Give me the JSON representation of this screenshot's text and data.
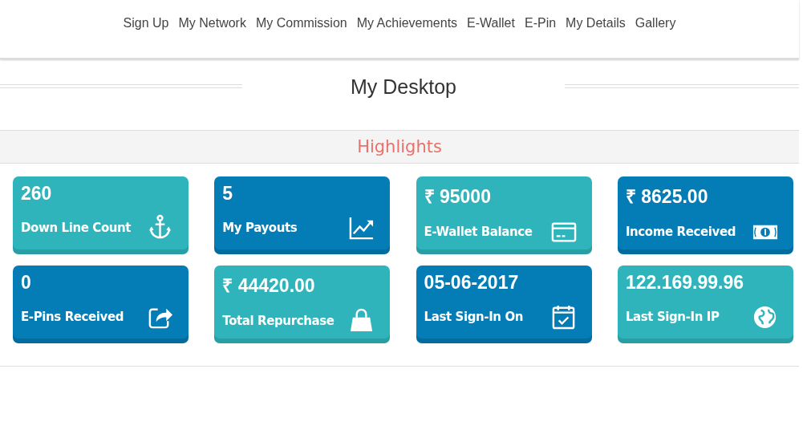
{
  "nav": {
    "items": [
      "Sign Up",
      "My Network",
      "My Commission",
      "My Achievements",
      "E-Wallet",
      "E-Pin",
      "My Details",
      "Gallery"
    ]
  },
  "page_title": "My Desktop",
  "section_title": "Highlights",
  "cards": [
    {
      "value": "260",
      "label": "Down Line Count",
      "color": "#2fb4bb"
    },
    {
      "value": "5",
      "label": "My Payouts",
      "color": "#047cb6"
    },
    {
      "value": "₹ 95000",
      "label": "E-Wallet Balance",
      "color": "#2fb4bb"
    },
    {
      "value": "₹ 8625.00",
      "label": "Income Received",
      "color": "#047cb6"
    },
    {
      "value": "0",
      "label": "E-Pins Received",
      "color": "#047cb6"
    },
    {
      "value": "₹ 44420.00",
      "label": "Total Repurchase",
      "color": "#2fb4bb"
    },
    {
      "value": "05-06-2017",
      "label": "Last Sign-In On",
      "color": "#047cb6"
    },
    {
      "value": "122.169.99.96",
      "label": "Last Sign-In IP",
      "color": "#2fb4bb"
    }
  ]
}
